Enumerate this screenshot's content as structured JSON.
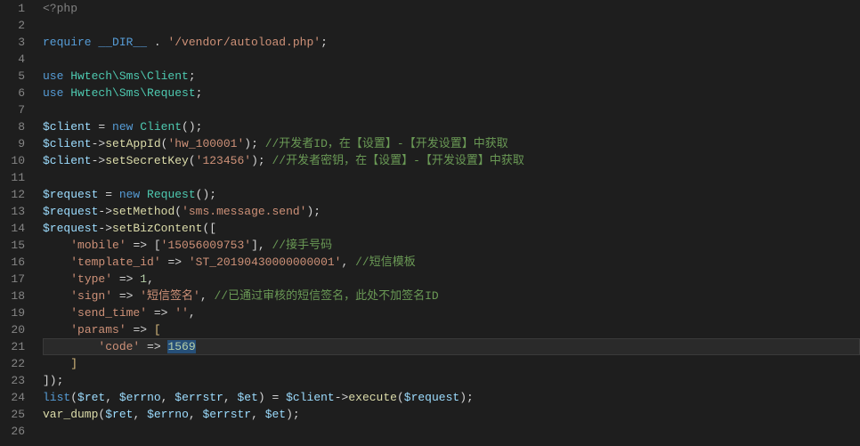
{
  "editor": {
    "language": "php",
    "current_line": 21,
    "selection_text": "1569",
    "bracket_highlight_lines": [
      20,
      22
    ],
    "gutter": [
      "1",
      "2",
      "3",
      "4",
      "5",
      "6",
      "7",
      "8",
      "9",
      "10",
      "11",
      "12",
      "13",
      "14",
      "15",
      "16",
      "17",
      "18",
      "19",
      "20",
      "21",
      "22",
      "23",
      "24",
      "25",
      "26"
    ],
    "tokens": {
      "l1": {
        "a": "<?php"
      },
      "l3": {
        "a": "require",
        "b": "__DIR__",
        "c": " . ",
        "d": "'/vendor/autoload.php'",
        "e": ";"
      },
      "l5": {
        "a": "use",
        "b": " Hwtech\\Sms\\",
        "c": "Client",
        "d": ";"
      },
      "l6": {
        "a": "use",
        "b": " Hwtech\\Sms\\",
        "c": "Request",
        "d": ";"
      },
      "l8": {
        "a": "$client",
        "b": " = ",
        "c": "new",
        "d": " ",
        "e": "Client",
        "f": "();"
      },
      "l9": {
        "a": "$client",
        "b": "->",
        "c": "setAppId",
        "d": "(",
        "e": "'hw_100001'",
        "f": "); ",
        "g": "//开发者ID，在【设置】-【开发设置】中获取"
      },
      "l10": {
        "a": "$client",
        "b": "->",
        "c": "setSecretKey",
        "d": "(",
        "e": "'123456'",
        "f": "); ",
        "g": "//开发者密钥，在【设置】-【开发设置】中获取"
      },
      "l12": {
        "a": "$request",
        "b": " = ",
        "c": "new",
        "d": " ",
        "e": "Request",
        "f": "();"
      },
      "l13": {
        "a": "$request",
        "b": "->",
        "c": "setMethod",
        "d": "(",
        "e": "'sms.message.send'",
        "f": ");"
      },
      "l14": {
        "a": "$request",
        "b": "->",
        "c": "setBizContent",
        "d": "(["
      },
      "l15": {
        "a": "    ",
        "b": "'mobile'",
        "c": " => [",
        "d": "'15056009753'",
        "e": "], ",
        "f": "//接手号码"
      },
      "l16": {
        "a": "    ",
        "b": "'template_id'",
        "c": " => ",
        "d": "'ST_20190430000000001'",
        "e": ", ",
        "f": "//短信模板"
      },
      "l17": {
        "a": "    ",
        "b": "'type'",
        "c": " => ",
        "d": "1",
        "e": ","
      },
      "l18": {
        "a": "    ",
        "b": "'sign'",
        "c": " => ",
        "d": "'短信签名'",
        "e": ", ",
        "f": "//已通过审核的短信签名，此处不加签名ID"
      },
      "l19": {
        "a": "    ",
        "b": "'send_time'",
        "c": " => ",
        "d": "''",
        "e": ","
      },
      "l20": {
        "a": "    ",
        "b": "'params'",
        "c": " => ",
        "d": "["
      },
      "l21": {
        "a": "        ",
        "b": "'code'",
        "c": " => ",
        "d": "1569"
      },
      "l22": {
        "a": "    ",
        "b": "]"
      },
      "l23": {
        "a": "]);"
      },
      "l24": {
        "a": "list",
        "b": "(",
        "c": "$ret",
        "d": ", ",
        "e": "$errno",
        "f": ", ",
        "g": "$errstr",
        "h": ", ",
        "i": "$et",
        "j": ") = ",
        "k": "$client",
        "l": "->",
        "m": "execute",
        "n": "(",
        "o": "$request",
        "p": ");"
      },
      "l25": {
        "a": "var_dump",
        "b": "(",
        "c": "$ret",
        "d": ", ",
        "e": "$errno",
        "f": ", ",
        "g": "$errstr",
        "h": ", ",
        "i": "$et",
        "j": ");"
      }
    }
  }
}
